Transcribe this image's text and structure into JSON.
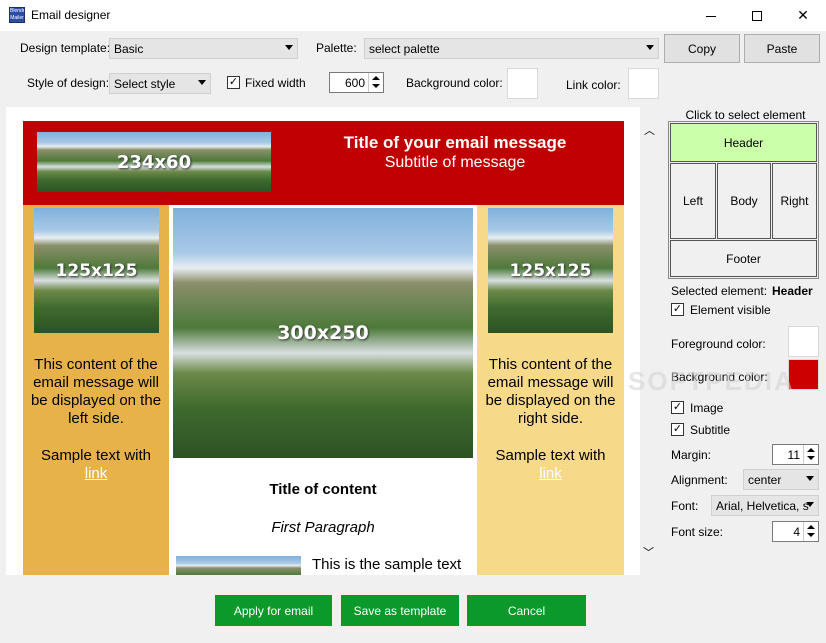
{
  "window": {
    "title": "Email designer",
    "icon_text": "Blender Mailer"
  },
  "toolbar": {
    "design_template_label": "Design template:",
    "design_template_value": "Basic",
    "palette_label": "Palette:",
    "palette_value": "select palette",
    "copy_label": "Copy",
    "paste_label": "Paste",
    "style_label": "Style of design:",
    "style_value": "Select style",
    "fixed_width_label": "Fixed width",
    "fixed_width_checked": true,
    "width_value": "600",
    "background_color_label": "Background color:",
    "link_color_label": "Link color:",
    "background_color": "#ffffff",
    "link_color": "#ffffff"
  },
  "preview": {
    "header_bg": "#c00000",
    "left_bg": "#e8b24a",
    "right_bg": "#f7d98a",
    "header_image_label": "234x60",
    "title": "Title of your email message",
    "subtitle": "Subtitle of message",
    "left_image_label": "125x125",
    "center_image_label": "300x250",
    "right_image_label": "125x125",
    "left_text": "This content of the email message will be displayed on the left side.",
    "right_text": "This content of the email message will be displayed on the right side.",
    "sample_text": "Sample text with",
    "link_text": "link",
    "content_title": "Title of content",
    "first_paragraph": "First Paragraph",
    "sample_body": "This is the sample text"
  },
  "panel": {
    "click_to_select": "Click to select element",
    "cells": {
      "header": "Header",
      "left": "Left",
      "body": "Body",
      "right": "Right",
      "footer": "Footer"
    },
    "header_cell_color": "#ccffaa",
    "selected_element_label": "Selected element:",
    "selected_element_value": "Header",
    "element_visible_label": "Element visible",
    "foreground_color_label": "Foreground color:",
    "foreground_color": "#ffffff",
    "background_color_label": "Background color:",
    "background_color": "#cc0000",
    "image_label": "Image",
    "subtitle_label": "Subtitle",
    "margin_label": "Margin:",
    "margin_value": "11",
    "alignment_label": "Alignment:",
    "alignment_value": "center",
    "font_label": "Font:",
    "font_value": "Arial, Helvetica, s",
    "font_size_label": "Font size:",
    "font_size_value": "4"
  },
  "footer": {
    "apply_label": "Apply for email",
    "save_label": "Save as template",
    "cancel_label": "Cancel",
    "button_color": "#0b9a2a"
  },
  "watermark": "SOFTPEDIA"
}
